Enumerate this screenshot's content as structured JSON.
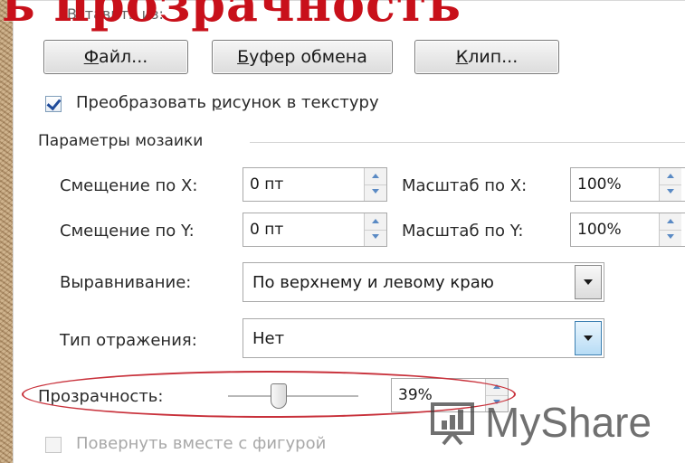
{
  "overlay": {
    "heading": "ь прозрачность",
    "faded_label": "Вставить из:"
  },
  "buttons": {
    "file": {
      "prefix": "",
      "underlined": "Ф",
      "rest": "айл..."
    },
    "clipboard": {
      "prefix": "",
      "underlined": "Б",
      "rest": "уфер обмена"
    },
    "clip": {
      "prefix": "",
      "underlined": "К",
      "rest": "лип..."
    }
  },
  "tile_checkbox": {
    "checked": true,
    "label_prefix": "Преобразовать ",
    "label_underlined": "р",
    "label_rest": "исунок в текстуру"
  },
  "tiling": {
    "section_title": "Параметры мозаики",
    "offset_x": {
      "label": "Смещение по X:",
      "value": "0 пт"
    },
    "offset_y": {
      "label": "Смещение по Y:",
      "value": "0 пт"
    },
    "scale_x": {
      "label": "Масштаб по X:",
      "value": "100%"
    },
    "scale_y": {
      "label": "Масштаб по Y:",
      "value": "100%"
    },
    "alignment": {
      "label": "Выравнивание:",
      "value": "По верхнему и левому краю"
    },
    "mirror": {
      "label": "Тип отражения:",
      "value": "Нет"
    }
  },
  "transparency": {
    "label": "Прозрачность:",
    "value": "39%",
    "level_percent": 39
  },
  "rotate_checkbox": {
    "checked": false,
    "label": "Повернуть вместе с фигурой"
  },
  "watermark": {
    "text": "MyShare"
  },
  "colors": {
    "heading_red": "#c8101a",
    "ellipse_red": "#c8303a",
    "spin_arrow_blue": "#5a8ac4"
  }
}
